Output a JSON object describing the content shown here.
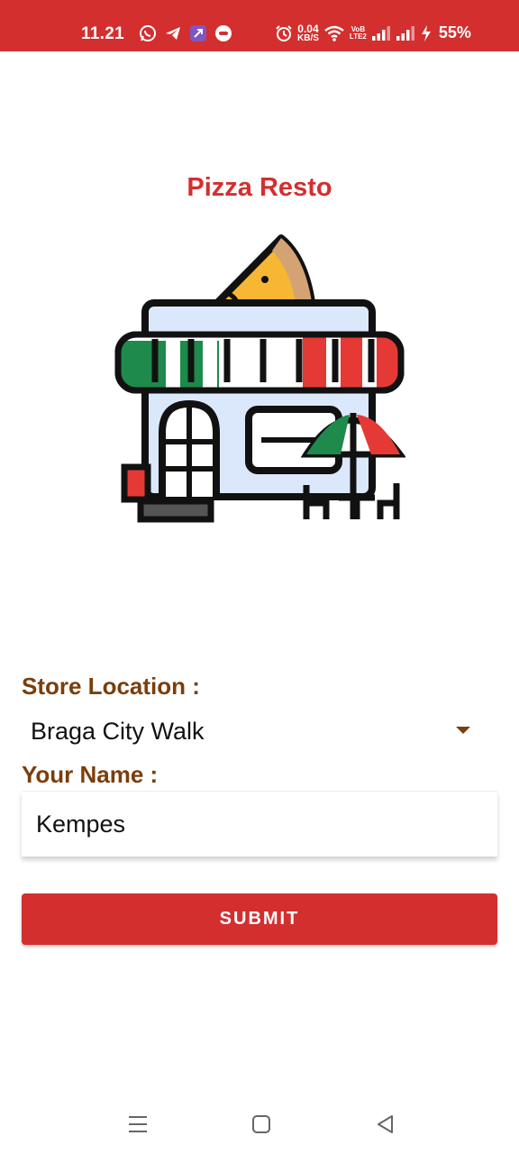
{
  "status_bar": {
    "time": "11.21",
    "net_speed_value": "0.04",
    "net_speed_unit": "KB/S",
    "volte_top": "VoB",
    "volte_bottom": "LTE2",
    "battery_percent": "55%",
    "icons": [
      "whatsapp-icon",
      "telegram-icon",
      "shortcut-app-icon",
      "chat-app-icon",
      "alarm-icon",
      "wifi-icon",
      "signal-icon",
      "signal-icon",
      "charging-icon"
    ]
  },
  "app": {
    "title": "Pizza Resto",
    "illustration": "pizza-store-icon"
  },
  "form": {
    "store_label": "Store Location :",
    "store_selected": "Braga City Walk",
    "name_label": "Your Name :",
    "name_value": "Kempes",
    "submit_label": "SUBMIT"
  },
  "nav_bar": {
    "icons": [
      "recent-apps-icon",
      "home-icon",
      "back-icon"
    ]
  },
  "colors": {
    "primary": "#d32f2f",
    "label_brown": "#7a3e0c",
    "awning_green": "#1e8a4c",
    "awning_red": "#e53935"
  }
}
